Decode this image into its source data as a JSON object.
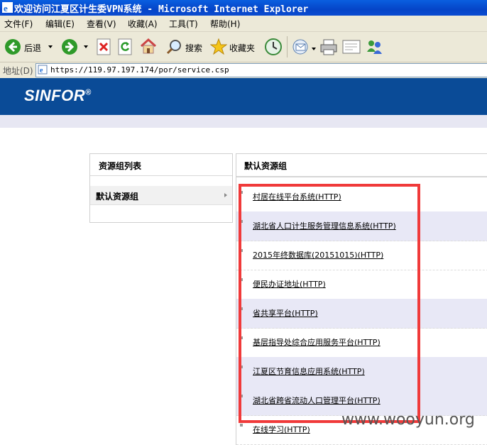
{
  "window": {
    "title": "欢迎访问江夏区计生委VPN系统 - Microsoft Internet Explorer"
  },
  "menu": [
    "文件(F)",
    "编辑(E)",
    "查看(V)",
    "收藏(A)",
    "工具(T)",
    "帮助(H)"
  ],
  "toolbar": {
    "back_label": "后退",
    "search_label": "搜索",
    "favorites_label": "收藏夹"
  },
  "address": {
    "label": "地址(D)",
    "url": "https://119.97.197.174/por/service.csp"
  },
  "brand": {
    "logo": "SINFOR",
    "reg": "®"
  },
  "left_panel": {
    "title": "资源组列表",
    "items": [
      "默认资源组"
    ]
  },
  "right_panel": {
    "title": "默认资源组",
    "resources": [
      "村居在线平台系统(HTTP)",
      "湖北省人口计生服务管理信息系统(HTTP)",
      "2015年终数据库(20151015)(HTTP)",
      "便民办证地址(HTTP)",
      "省共享平台(HTTP)",
      "基层指导处综合应用服务平台(HTTP)",
      "江夏区节育信息应用系统(HTTP)",
      "湖北省跨省流动人口管理平台(HTTP)",
      "在线学习(HTTP)"
    ]
  },
  "watermark": "www.wooyun.org",
  "colors": {
    "titlebar": "#0545c8",
    "banner": "#0a4b97",
    "highlight": "#f03a3a",
    "alt_row": "#e8e8f6"
  }
}
